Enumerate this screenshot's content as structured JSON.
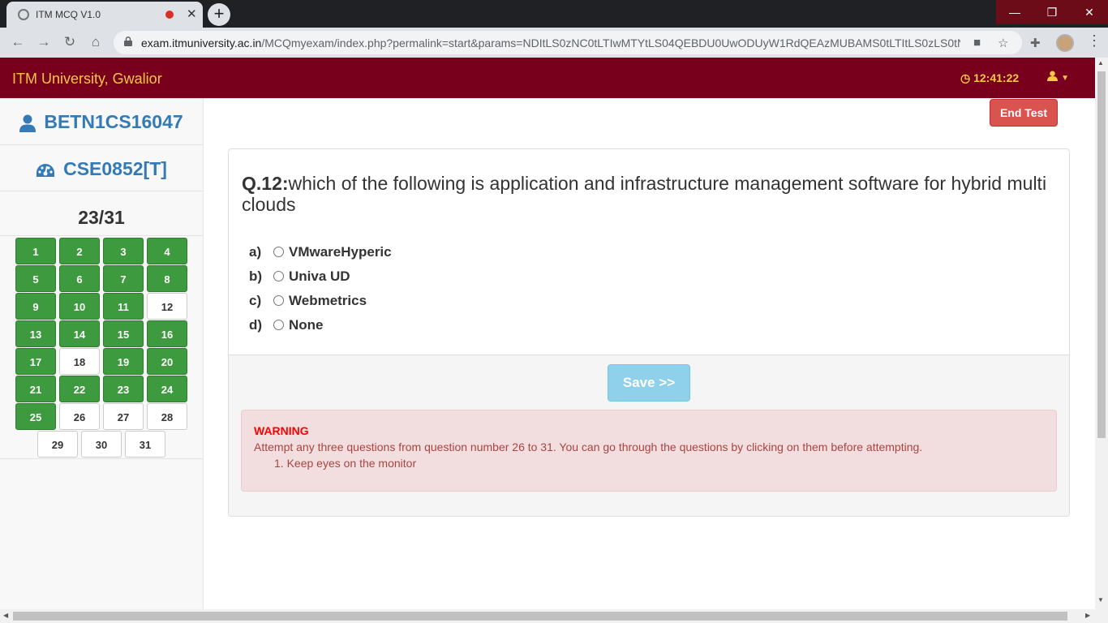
{
  "browser": {
    "tab_title": "ITM MCQ V1.0",
    "url_host": "exam.itmuniversity.ac.in",
    "url_path": "/MCQmyexam/index.php?permalink=start&params=NDItLS0zNC0tLTIwMTYtLS04QEBDU0UwODUyW1RdQEAzMUBAMS0tLTItLS0zLS0tNC..."
  },
  "header": {
    "brand": "ITM University, Gwalior",
    "timer": "12:41:22"
  },
  "sidebar": {
    "roll_no": "BETN1CS16047",
    "course_code": "CSE0852[T]",
    "progress": "23/31",
    "questions": [
      {
        "label": "1",
        "answered": true
      },
      {
        "label": "2",
        "answered": true
      },
      {
        "label": "3",
        "answered": true
      },
      {
        "label": "4",
        "answered": true
      },
      {
        "label": "5",
        "answered": true
      },
      {
        "label": "6",
        "answered": true
      },
      {
        "label": "7",
        "answered": true
      },
      {
        "label": "8",
        "answered": true
      },
      {
        "label": "9",
        "answered": true
      },
      {
        "label": "10",
        "answered": true
      },
      {
        "label": "11",
        "answered": true
      },
      {
        "label": "12",
        "answered": false
      },
      {
        "label": "13",
        "answered": true
      },
      {
        "label": "14",
        "answered": true
      },
      {
        "label": "15",
        "answered": true
      },
      {
        "label": "16",
        "answered": true
      },
      {
        "label": "17",
        "answered": true
      },
      {
        "label": "18",
        "answered": false
      },
      {
        "label": "19",
        "answered": true
      },
      {
        "label": "20",
        "answered": true
      },
      {
        "label": "21",
        "answered": true
      },
      {
        "label": "22",
        "answered": true
      },
      {
        "label": "23",
        "answered": true
      },
      {
        "label": "24",
        "answered": true
      },
      {
        "label": "25",
        "answered": true
      },
      {
        "label": "26",
        "answered": false
      },
      {
        "label": "27",
        "answered": false
      },
      {
        "label": "28",
        "answered": false
      },
      {
        "label": "29",
        "answered": false
      },
      {
        "label": "30",
        "answered": false
      },
      {
        "label": "31",
        "answered": false
      }
    ]
  },
  "main": {
    "end_test_label": "End Test",
    "question_number": "Q.12:",
    "question_text": "which of the following is application and infrastructure management software for hybrid multi clouds",
    "options": [
      {
        "letter": "a)",
        "text": "VMwareHyperic"
      },
      {
        "letter": "b)",
        "text": "Univa UD"
      },
      {
        "letter": "c)",
        "text": "Webmetrics"
      },
      {
        "letter": "d)",
        "text": "None"
      }
    ],
    "save_label": "Save >>",
    "warning_title": "WARNING",
    "warning_text": "Attempt any three questions from question number 26 to 31. You can go through the questions by clicking on them before attempting.",
    "instruction": "1. Keep eyes on the monitor"
  },
  "colors": {
    "header_bg": "#78001c",
    "brand_text": "#f7c744",
    "answered": "#3e9a3e",
    "link_blue": "#337ab7",
    "danger": "#d9534f",
    "save_disabled": "#8fd0ea"
  }
}
